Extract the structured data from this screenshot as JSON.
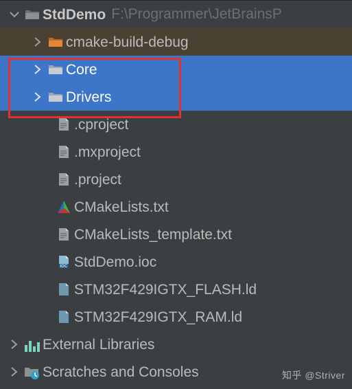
{
  "project": {
    "name": "StdDemo",
    "path": "F:\\Programmer\\JetBrainsP"
  },
  "tree": {
    "cmake_build_debug": "cmake-build-debug",
    "core": "Core",
    "drivers": "Drivers",
    "cproject": ".cproject",
    "mxproject": ".mxproject",
    "project": ".project",
    "cmakelists": "CMakeLists.txt",
    "cmakelists_template": "CMakeLists_template.txt",
    "ioc": "StdDemo.ioc",
    "flash_ld": "STM32F429IGTX_FLASH.ld",
    "ram_ld": "STM32F429IGTX_RAM.ld"
  },
  "bottom": {
    "external_libraries": "External Libraries",
    "scratches": "Scratches and Consoles"
  },
  "watermark": "知乎 @Striver"
}
